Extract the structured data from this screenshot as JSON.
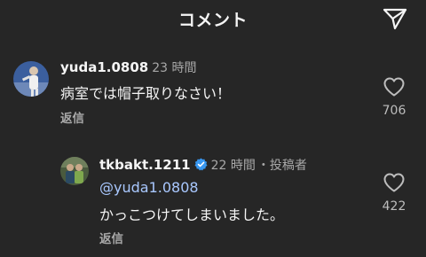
{
  "header": {
    "title": "コメント",
    "send_icon": "paper-plane-icon"
  },
  "comments": [
    {
      "username": "yuda1.0808",
      "time": "23 時間",
      "text": "病室では帽子取りなさい！",
      "reply_label": "返信",
      "likes": "706",
      "like_icon": "heart-outline-icon"
    },
    {
      "username": "tkbakt.1211",
      "verified_icon": "verified-badge-icon",
      "time": "22 時間",
      "author_tag": "・投稿者",
      "mention": "@yuda1.0808",
      "text": "かっこつけてしまいました。",
      "reply_label": "返信",
      "likes": "422",
      "like_icon": "heart-outline-icon"
    }
  ],
  "colors": {
    "background": "#262626",
    "text": "#f5f5f5",
    "muted": "#a8a8a8",
    "mention": "#a9c8ff",
    "verified": "#3897f0"
  }
}
